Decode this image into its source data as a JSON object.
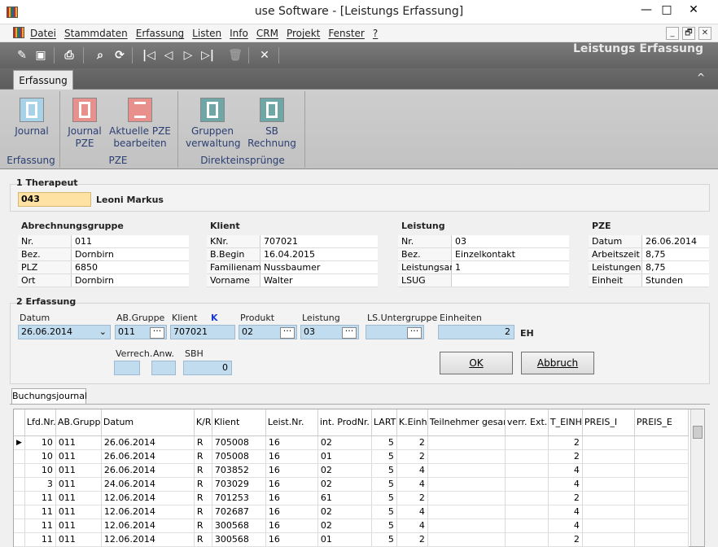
{
  "window": {
    "title": "use Software - [Leistungs Erfassung]",
    "minimize": "—",
    "maximize": "□",
    "close": "✕"
  },
  "menu": [
    "Datei",
    "Stammdaten",
    "Erfassung",
    "Listen",
    "Info",
    "CRM",
    "Projekt",
    "Fenster",
    "?"
  ],
  "mdi": {
    "minimize": "_",
    "restore": "🗗",
    "close": "✕"
  },
  "toolbar": {
    "form_title": "Leistungs Erfassung"
  },
  "ribbon": {
    "tab": "Erfassung",
    "collapse": "^",
    "buttons": [
      {
        "label1": "Journal",
        "label2": ""
      },
      {
        "label1": "Journal",
        "label2": "PZE"
      },
      {
        "label1": "Aktuelle PZE",
        "label2": "bearbeiten"
      },
      {
        "label1": "Gruppen",
        "label2": "verwaltung"
      },
      {
        "label1": "SB",
        "label2": "Rechnung"
      }
    ],
    "groups": [
      "Erfassung",
      "PZE",
      "Direkteinsprünge"
    ]
  },
  "therapeut": {
    "section": "1 Therapeut",
    "code": "043",
    "name": "Leoni Markus"
  },
  "abrechnungsgruppe": {
    "header": "Abrechnungsgruppe",
    "rows": [
      [
        "Nr.",
        "011"
      ],
      [
        "Bez.",
        "Dornbirn"
      ],
      [
        "PLZ",
        "6850"
      ],
      [
        "Ort",
        "Dornbirn"
      ]
    ]
  },
  "klient": {
    "header": "Klient",
    "rows": [
      [
        "KNr.",
        "707021"
      ],
      [
        "B.Begin",
        "16.04.2015"
      ],
      [
        "Familiename",
        "Nussbaumer"
      ],
      [
        "Vorname",
        "Walter"
      ]
    ]
  },
  "leistung": {
    "header": "Leistung",
    "rows": [
      [
        "Nr.",
        "03"
      ],
      [
        "Bez.",
        "Einzelkontakt"
      ],
      [
        "Leistungsart",
        "1"
      ],
      [
        "LSUG",
        ""
      ]
    ]
  },
  "pze": {
    "header": "PZE",
    "rows": [
      [
        "Datum",
        "26.06.2014"
      ],
      [
        "Arbeitszeit",
        "8,75"
      ],
      [
        "Leistungen",
        "8,75"
      ],
      [
        "Einheit",
        "Stunden"
      ]
    ]
  },
  "erfassung": {
    "section": "2 Erfassung",
    "labels": {
      "datum": "Datum",
      "abgruppe": "AB.Gruppe",
      "klient": "Klient",
      "klient_k": "K",
      "produkt": "Produkt",
      "leistung": "Leistung",
      "lsunter": "LS.Untergruppe",
      "einheiten": "Einheiten",
      "eh": "EH",
      "verrech": "Verrech.",
      "anw": "Anw.",
      "sbh": "SBH"
    },
    "values": {
      "datum": "26.06.2014",
      "abgruppe": "011",
      "klient": "707021",
      "produkt": "02",
      "leistung": "03",
      "lsunter": "",
      "einheiten": "2",
      "verrech": "",
      "anw": "",
      "sbh": "0"
    },
    "ok": "OK",
    "abbruch": "Abbruch"
  },
  "journal": {
    "tab": "Buchungsjournal",
    "columns": [
      "Lfd.Nr.",
      "AB.Gruppe",
      "Datum",
      "K/R",
      "Klient",
      "Leist.Nr.",
      "int. ProdNr.",
      "LART",
      "K.Einh",
      "Teilnehmer gesam.",
      "verr. Ext.",
      "T_EINH",
      "PREIS_I",
      "PREIS_E"
    ],
    "rows": [
      [
        "10",
        "011",
        "26.06.2014",
        "R",
        "705008",
        "16",
        "02",
        "5",
        "2",
        "",
        "",
        "2",
        "",
        ""
      ],
      [
        "10",
        "011",
        "26.06.2014",
        "R",
        "705008",
        "16",
        "01",
        "5",
        "2",
        "",
        "",
        "2",
        "",
        ""
      ],
      [
        "10",
        "011",
        "26.06.2014",
        "R",
        "703852",
        "16",
        "02",
        "5",
        "4",
        "",
        "",
        "4",
        "",
        ""
      ],
      [
        "3",
        "011",
        "24.06.2014",
        "R",
        "703029",
        "16",
        "02",
        "5",
        "4",
        "",
        "",
        "4",
        "",
        ""
      ],
      [
        "11",
        "011",
        "12.06.2014",
        "R",
        "701253",
        "16",
        "61",
        "5",
        "2",
        "",
        "",
        "2",
        "",
        ""
      ],
      [
        "11",
        "011",
        "12.06.2014",
        "R",
        "702687",
        "16",
        "02",
        "5",
        "4",
        "",
        "",
        "4",
        "",
        ""
      ],
      [
        "11",
        "011",
        "12.06.2014",
        "R",
        "300568",
        "16",
        "02",
        "5",
        "4",
        "",
        "",
        "4",
        "",
        ""
      ],
      [
        "11",
        "011",
        "12.06.2014",
        "R",
        "300568",
        "16",
        "01",
        "5",
        "2",
        "",
        "",
        "2",
        "",
        ""
      ]
    ]
  }
}
